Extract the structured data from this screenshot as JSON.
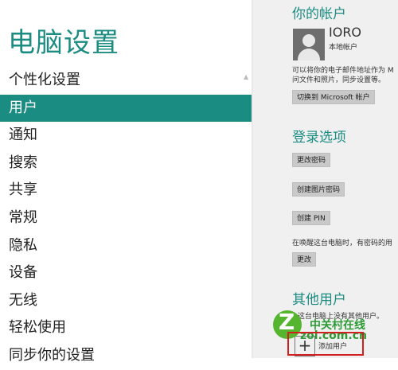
{
  "sidebar": {
    "title": "电脑设置",
    "items": [
      {
        "label": "个性化设置",
        "selected": false
      },
      {
        "label": "用户",
        "selected": true
      },
      {
        "label": "通知",
        "selected": false
      },
      {
        "label": "搜索",
        "selected": false
      },
      {
        "label": "共享",
        "selected": false
      },
      {
        "label": "常规",
        "selected": false
      },
      {
        "label": "隐私",
        "selected": false
      },
      {
        "label": "设备",
        "selected": false
      },
      {
        "label": "无线",
        "selected": false
      },
      {
        "label": "轻松使用",
        "selected": false
      },
      {
        "label": "同步你的设置",
        "selected": false
      }
    ]
  },
  "account": {
    "section_title": "你的帐户",
    "user_name": "IORO",
    "user_type": "本地帐户",
    "description_line1": "可以将你的电子邮件地址作为 M",
    "description_line2": "问文件和照片，同步设置等。",
    "switch_button": "切换到 Microsoft 帐户"
  },
  "login": {
    "section_title": "登录选项",
    "change_password_button": "更改密码",
    "picture_password_button": "创建图片密码",
    "pin_button": "创建 PIN",
    "wake_text": "在唤醒这台电脑时，有密码的用",
    "change_button": "更改"
  },
  "other_users": {
    "section_title": "其他用户",
    "description": "这台电脑上没有其他用户。",
    "add_user_label": "添加用户",
    "add_user_icon": "plus-icon"
  },
  "watermark": {
    "logo_letter": "Z",
    "site_cn": "中关村在线",
    "site": "zol.com.cn"
  },
  "colors": {
    "accent": "#1b8c82",
    "content_bg": "#f0f0f0",
    "highlight": "#d21f1f"
  }
}
